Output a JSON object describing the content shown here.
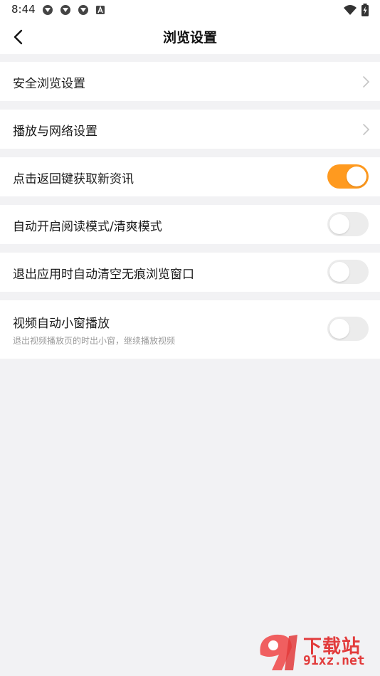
{
  "status_bar": {
    "time": "8:44",
    "icons": [
      "app-icon",
      "app-icon",
      "app-icon",
      "app-a-icon",
      "wifi-icon",
      "battery-icon"
    ]
  },
  "header": {
    "title": "浏览设置",
    "back_icon": "chevron-left-icon"
  },
  "settings": [
    {
      "label": "安全浏览设置",
      "type": "link"
    },
    {
      "label": "播放与网络设置",
      "type": "link"
    },
    {
      "label": "点击返回键获取新资讯",
      "type": "toggle",
      "on": true
    },
    {
      "label": "自动开启阅读模式/清爽模式",
      "type": "toggle",
      "on": false
    },
    {
      "label": "退出应用时自动清空无痕浏览窗口",
      "type": "toggle",
      "on": false
    },
    {
      "label": "视频自动小窗播放",
      "sublabel": "退出视频播放页的时出小窗，继续播放视频",
      "type": "toggle",
      "on": false
    }
  ],
  "watermark": {
    "title": "下载站",
    "site": "91xz.net"
  },
  "colors": {
    "accent": "#ff9a1f",
    "background": "#f2f2f4",
    "toggle_off": "#ececec",
    "watermark": "#e23b3b"
  }
}
